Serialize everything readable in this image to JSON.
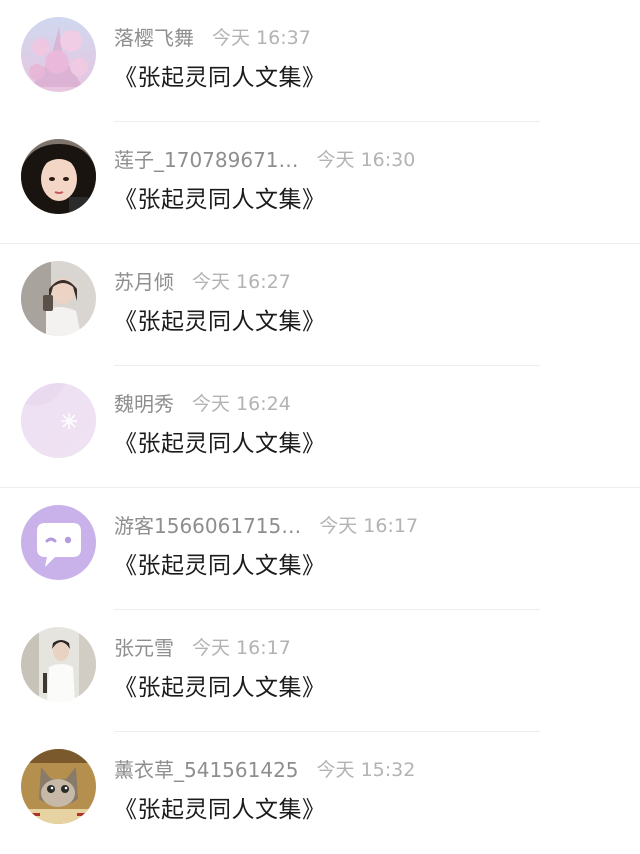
{
  "comments": [
    {
      "name": "落樱飞舞",
      "time": "今天 16:37",
      "text": "《张起灵同人文集》",
      "avatar": "cherry-blossom-avatar"
    },
    {
      "name": "莲子_170789671…",
      "time": "今天 16:30",
      "text": "《张起灵同人文集》",
      "avatar": "anime-girl-avatar"
    },
    {
      "name": "苏月倾",
      "time": "今天 16:27",
      "text": "《张起灵同人文集》",
      "avatar": "selfie-girl-avatar"
    },
    {
      "name": "魏明秀",
      "time": "今天 16:24",
      "text": "《张起灵同人文集》",
      "avatar": "lavender-flower-avatar"
    },
    {
      "name": "游客1566061715…",
      "time": "今天 16:17",
      "text": "《张起灵同人文集》",
      "avatar": "default-chat-bubble-avatar"
    },
    {
      "name": "张元雪",
      "time": "今天 16:17",
      "text": "《张起灵同人文集》",
      "avatar": "man-in-white-avatar"
    },
    {
      "name": "薰衣草_541561425",
      "time": "今天 15:32",
      "text": "《张起灵同人文集》",
      "avatar": "kitten-avatar"
    }
  ],
  "colors": {
    "name": "#8e8e8e",
    "time": "#b3b3b3",
    "text": "#1b1b1b",
    "default_avatar": "#c9b2ea"
  }
}
